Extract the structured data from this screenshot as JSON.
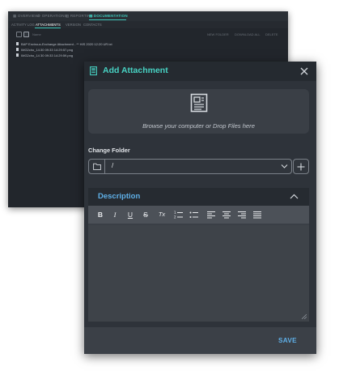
{
  "background_window": {
    "nav": [
      {
        "label": "OVERVIEW",
        "icon": "grid-icon"
      },
      {
        "label": "OPERATIONS",
        "icon": "gear-icon"
      },
      {
        "label": "REPORTING",
        "icon": "chart-icon"
      },
      {
        "label": "DOCUMENTATION",
        "icon": "document-icon",
        "active": true
      }
    ],
    "subtabs": [
      {
        "label": "ACTIVITY LOG"
      },
      {
        "label": "ATTACHMENTS",
        "active": true
      },
      {
        "label": "VERSION"
      },
      {
        "label": "CONTACTS"
      }
    ],
    "toolbar_label": "Name",
    "toolbar_right": [
      "NEW FOLDER",
      "DOWNLOAD ALL",
      "DELETE"
    ],
    "files": [
      "BAP Enviroux-Exchange Attachment - ** HIS 2020 12:20 UR.txt",
      "IMG2cho_14:30 09:33 14:29:57.png",
      "IMG2cho_14 30 09:33 14:29:59.png"
    ]
  },
  "modal": {
    "title": "Add Attachment",
    "title_icon": "document-icon",
    "close_icon": "close-icon",
    "dropzone": {
      "icon": "document-icon",
      "text": "Browse your computer or Drop Files here"
    },
    "folder": {
      "label": "Change Folder",
      "value": "/",
      "folder_icon": "folder-icon",
      "chevron_icon": "chevron-down-icon",
      "add_icon": "plus-icon"
    },
    "description": {
      "title": "Description",
      "collapse_icon": "chevron-up-icon",
      "toolbar": [
        {
          "name": "bold-button",
          "glyph": "B"
        },
        {
          "name": "italic-button",
          "glyph": "I"
        },
        {
          "name": "underline-button",
          "glyph": "U"
        },
        {
          "name": "strikethrough-button",
          "glyph": "S"
        },
        {
          "name": "clear-format-button",
          "glyph": "Tx"
        },
        {
          "name": "ordered-list-button",
          "glyph": "ordered-list-icon"
        },
        {
          "name": "bullet-list-button",
          "glyph": "bullet-list-icon"
        },
        {
          "name": "align-left-button",
          "glyph": "align-left-icon"
        },
        {
          "name": "align-center-button",
          "glyph": "align-center-icon"
        },
        {
          "name": "align-right-button",
          "glyph": "align-right-icon"
        },
        {
          "name": "align-justify-button",
          "glyph": "align-justify-icon"
        }
      ],
      "editor_value": ""
    },
    "save_label": "SAVE"
  },
  "colors": {
    "accent_teal": "#47d1c2",
    "accent_blue": "#5fb0e8",
    "modal_bg": "#2e333a",
    "page_bg": "#22262c"
  }
}
